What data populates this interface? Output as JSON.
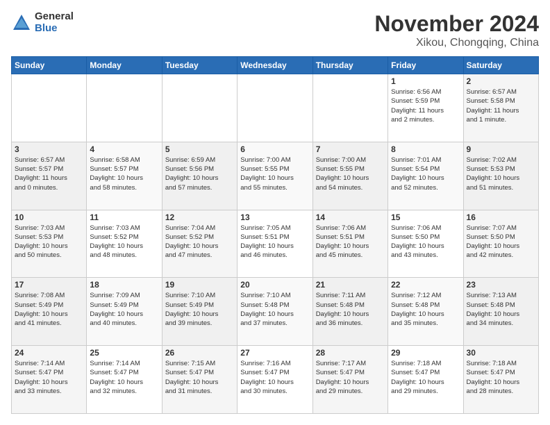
{
  "logo": {
    "general": "General",
    "blue": "Blue"
  },
  "title": {
    "month": "November 2024",
    "location": "Xikou, Chongqing, China"
  },
  "weekdays": [
    "Sunday",
    "Monday",
    "Tuesday",
    "Wednesday",
    "Thursday",
    "Friday",
    "Saturday"
  ],
  "weeks": [
    [
      {
        "day": "",
        "info": ""
      },
      {
        "day": "",
        "info": ""
      },
      {
        "day": "",
        "info": ""
      },
      {
        "day": "",
        "info": ""
      },
      {
        "day": "",
        "info": ""
      },
      {
        "day": "1",
        "info": "Sunrise: 6:56 AM\nSunset: 5:59 PM\nDaylight: 11 hours\nand 2 minutes."
      },
      {
        "day": "2",
        "info": "Sunrise: 6:57 AM\nSunset: 5:58 PM\nDaylight: 11 hours\nand 1 minute."
      }
    ],
    [
      {
        "day": "3",
        "info": "Sunrise: 6:57 AM\nSunset: 5:57 PM\nDaylight: 11 hours\nand 0 minutes."
      },
      {
        "day": "4",
        "info": "Sunrise: 6:58 AM\nSunset: 5:57 PM\nDaylight: 10 hours\nand 58 minutes."
      },
      {
        "day": "5",
        "info": "Sunrise: 6:59 AM\nSunset: 5:56 PM\nDaylight: 10 hours\nand 57 minutes."
      },
      {
        "day": "6",
        "info": "Sunrise: 7:00 AM\nSunset: 5:55 PM\nDaylight: 10 hours\nand 55 minutes."
      },
      {
        "day": "7",
        "info": "Sunrise: 7:00 AM\nSunset: 5:55 PM\nDaylight: 10 hours\nand 54 minutes."
      },
      {
        "day": "8",
        "info": "Sunrise: 7:01 AM\nSunset: 5:54 PM\nDaylight: 10 hours\nand 52 minutes."
      },
      {
        "day": "9",
        "info": "Sunrise: 7:02 AM\nSunset: 5:53 PM\nDaylight: 10 hours\nand 51 minutes."
      }
    ],
    [
      {
        "day": "10",
        "info": "Sunrise: 7:03 AM\nSunset: 5:53 PM\nDaylight: 10 hours\nand 50 minutes."
      },
      {
        "day": "11",
        "info": "Sunrise: 7:03 AM\nSunset: 5:52 PM\nDaylight: 10 hours\nand 48 minutes."
      },
      {
        "day": "12",
        "info": "Sunrise: 7:04 AM\nSunset: 5:52 PM\nDaylight: 10 hours\nand 47 minutes."
      },
      {
        "day": "13",
        "info": "Sunrise: 7:05 AM\nSunset: 5:51 PM\nDaylight: 10 hours\nand 46 minutes."
      },
      {
        "day": "14",
        "info": "Sunrise: 7:06 AM\nSunset: 5:51 PM\nDaylight: 10 hours\nand 45 minutes."
      },
      {
        "day": "15",
        "info": "Sunrise: 7:06 AM\nSunset: 5:50 PM\nDaylight: 10 hours\nand 43 minutes."
      },
      {
        "day": "16",
        "info": "Sunrise: 7:07 AM\nSunset: 5:50 PM\nDaylight: 10 hours\nand 42 minutes."
      }
    ],
    [
      {
        "day": "17",
        "info": "Sunrise: 7:08 AM\nSunset: 5:49 PM\nDaylight: 10 hours\nand 41 minutes."
      },
      {
        "day": "18",
        "info": "Sunrise: 7:09 AM\nSunset: 5:49 PM\nDaylight: 10 hours\nand 40 minutes."
      },
      {
        "day": "19",
        "info": "Sunrise: 7:10 AM\nSunset: 5:49 PM\nDaylight: 10 hours\nand 39 minutes."
      },
      {
        "day": "20",
        "info": "Sunrise: 7:10 AM\nSunset: 5:48 PM\nDaylight: 10 hours\nand 37 minutes."
      },
      {
        "day": "21",
        "info": "Sunrise: 7:11 AM\nSunset: 5:48 PM\nDaylight: 10 hours\nand 36 minutes."
      },
      {
        "day": "22",
        "info": "Sunrise: 7:12 AM\nSunset: 5:48 PM\nDaylight: 10 hours\nand 35 minutes."
      },
      {
        "day": "23",
        "info": "Sunrise: 7:13 AM\nSunset: 5:48 PM\nDaylight: 10 hours\nand 34 minutes."
      }
    ],
    [
      {
        "day": "24",
        "info": "Sunrise: 7:14 AM\nSunset: 5:47 PM\nDaylight: 10 hours\nand 33 minutes."
      },
      {
        "day": "25",
        "info": "Sunrise: 7:14 AM\nSunset: 5:47 PM\nDaylight: 10 hours\nand 32 minutes."
      },
      {
        "day": "26",
        "info": "Sunrise: 7:15 AM\nSunset: 5:47 PM\nDaylight: 10 hours\nand 31 minutes."
      },
      {
        "day": "27",
        "info": "Sunrise: 7:16 AM\nSunset: 5:47 PM\nDaylight: 10 hours\nand 30 minutes."
      },
      {
        "day": "28",
        "info": "Sunrise: 7:17 AM\nSunset: 5:47 PM\nDaylight: 10 hours\nand 29 minutes."
      },
      {
        "day": "29",
        "info": "Sunrise: 7:18 AM\nSunset: 5:47 PM\nDaylight: 10 hours\nand 29 minutes."
      },
      {
        "day": "30",
        "info": "Sunrise: 7:18 AM\nSunset: 5:47 PM\nDaylight: 10 hours\nand 28 minutes."
      }
    ]
  ]
}
